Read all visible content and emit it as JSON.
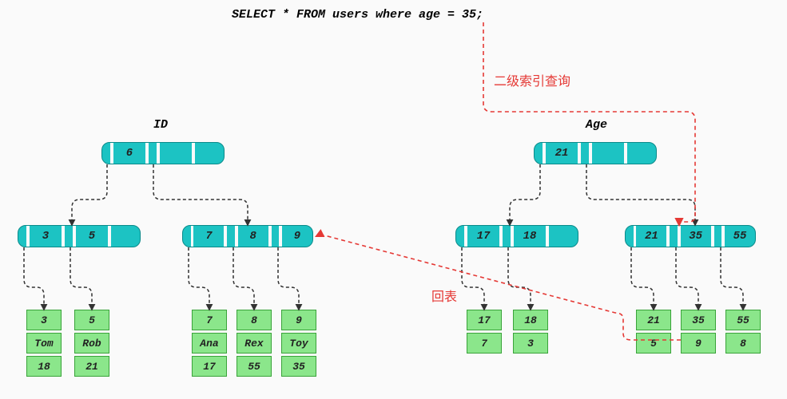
{
  "query": "SELECT * FROM users where age = 35;",
  "trees": {
    "id": {
      "label": "ID",
      "root": [
        "6"
      ],
      "mid_left": [
        "3",
        "5"
      ],
      "mid_right": [
        "7",
        "8",
        "9"
      ],
      "leaves": [
        {
          "id": "3",
          "name": "Tom",
          "val": "18"
        },
        {
          "id": "5",
          "name": "Rob",
          "val": "21"
        },
        {
          "id": "7",
          "name": "Ana",
          "val": "17"
        },
        {
          "id": "8",
          "name": "Rex",
          "val": "55"
        },
        {
          "id": "9",
          "name": "Toy",
          "val": "35"
        }
      ]
    },
    "age": {
      "label": "Age",
      "root": [
        "21"
      ],
      "mid_left": [
        "17",
        "18"
      ],
      "mid_right": [
        "21",
        "35",
        "55"
      ],
      "leaves": [
        {
          "id": "17",
          "pk": "7"
        },
        {
          "id": "18",
          "pk": "3"
        },
        {
          "id": "21",
          "pk": "5"
        },
        {
          "id": "35",
          "pk": "9"
        },
        {
          "id": "55",
          "pk": "8"
        }
      ]
    }
  },
  "annotations": {
    "secondary_index": "二级索引查询",
    "back_to_table": "回表"
  },
  "watermark": ""
}
